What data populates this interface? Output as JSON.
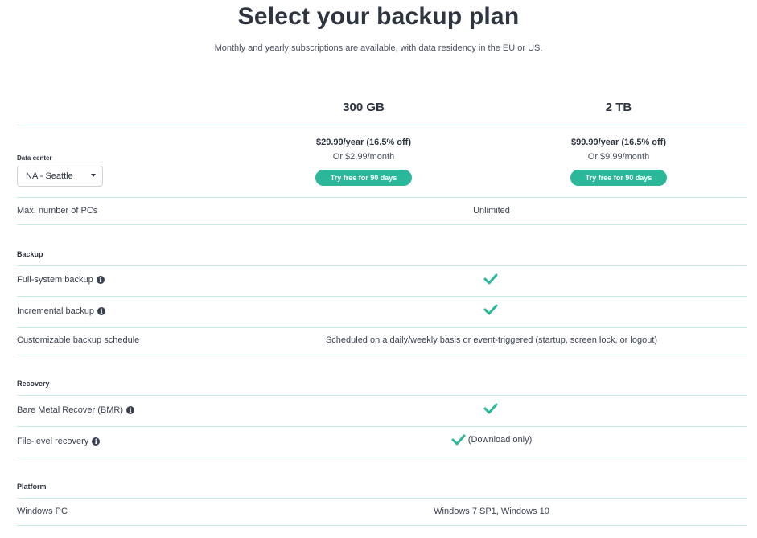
{
  "header": {
    "title": "Select your backup plan",
    "subtitle": "Monthly and yearly subscriptions are available, with data residency in the EU or US."
  },
  "plans": [
    {
      "name": "300 GB",
      "price_year": "$29.99/year (16.5% off)",
      "price_month": "Or $2.99/month",
      "cta": "Try free for 90 days"
    },
    {
      "name": "2 TB",
      "price_year": "$99.99/year (16.5% off)",
      "price_month": "Or $9.99/month",
      "cta": "Try free for 90 days"
    }
  ],
  "data_center": {
    "label": "Data center",
    "selected": "NA - Seattle"
  },
  "rows": {
    "max_pcs": {
      "label": "Max. number of PCs",
      "value": "Unlimited"
    },
    "backup_section": "Backup",
    "full_system": {
      "label": "Full-system backup",
      "value_icon": "check-icon"
    },
    "incremental": {
      "label": "Incremental backup",
      "value_icon": "check-icon"
    },
    "schedule": {
      "label": "Customizable backup schedule",
      "value": "Scheduled on a daily/weekly basis or event-triggered (startup, screen lock, or logout)"
    },
    "recovery_section": "Recovery",
    "bmr": {
      "label": "Bare Metal Recover (BMR)",
      "value_icon": "check-icon"
    },
    "file_level": {
      "label": "File-level recovery",
      "value_icon": "check-icon",
      "note": "(Download only)"
    },
    "platform_section": "Platform",
    "windows_pc": {
      "label": "Windows PC",
      "value": "Windows 7 SP1, Windows 10"
    }
  },
  "colors": {
    "accent": "#2bb89a",
    "divider": "#c9ece2",
    "text": "#3b4151"
  },
  "icons": {
    "info": "i"
  }
}
